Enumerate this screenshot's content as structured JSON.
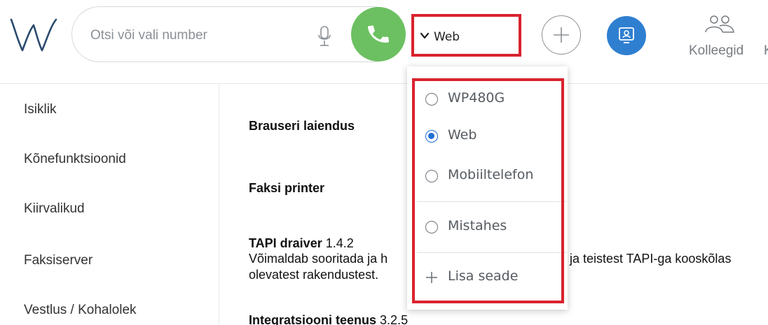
{
  "header": {
    "search_placeholder": "Otsi või vali number",
    "device_selected": "Web",
    "colleagues_label": "Kolleegid",
    "cut_label": "K"
  },
  "sidebar": {
    "items": [
      {
        "label": "Isiklik"
      },
      {
        "label": "Kõnefunktsioonid"
      },
      {
        "label": "Kiirvalikud"
      },
      {
        "label": "Faksiserver"
      },
      {
        "label": "Vestlus / Kohalolek"
      }
    ]
  },
  "main": {
    "sections": [
      {
        "title": "Brauseri laiendus"
      },
      {
        "title": "Faksi printer"
      },
      {
        "title": "TAPI draiver",
        "version": "1.4.2",
        "desc_line1_start": "Võimaldab sooritada ja h",
        "desc_line1_end": "ja teistest TAPI-ga kooskõlas",
        "desc_line2": "olevatest rakendustest."
      },
      {
        "title": "Integratsiooni teenus",
        "version": "3.2.5"
      }
    ]
  },
  "device_dropdown": {
    "options": [
      {
        "label": "WP480G",
        "selected": false
      },
      {
        "label": "Web",
        "selected": true
      },
      {
        "label": "Mobiiltelefon",
        "selected": false
      },
      {
        "label": "Mistahes",
        "selected": false
      }
    ],
    "add_label": "Lisa seade"
  },
  "colors": {
    "call_green": "#6cc061",
    "accent_blue": "#2f7fd1",
    "highlight_red": "#d9232e"
  },
  "icons": [
    "w-logo",
    "mic-icon",
    "phone-icon",
    "chevron-down-icon",
    "plus-icon",
    "presence-icon",
    "colleagues-icon",
    "radio-icon"
  ]
}
